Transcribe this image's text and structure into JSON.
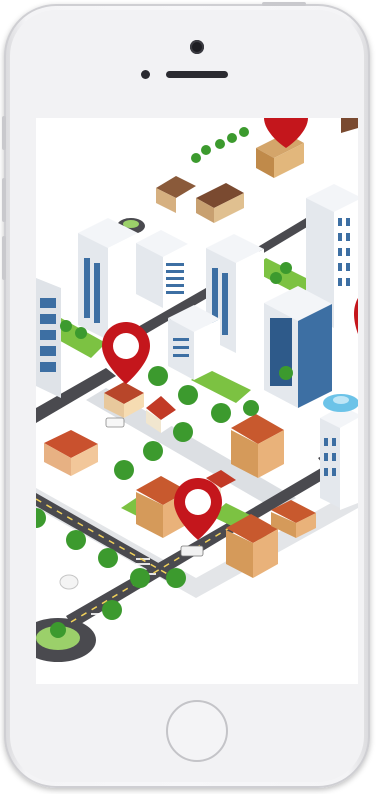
{
  "device": {
    "model": "iPhone",
    "color": "#f2f2f4"
  },
  "screen": {
    "content": "isometric-city-map",
    "pins": 4,
    "pin_color": "#c4161c"
  },
  "colors": {
    "road": "#4a4a4f",
    "grass": "#7cc242",
    "tree": "#3c9a2e",
    "roof": "#b8462a",
    "building": "#e9edf2",
    "glass": "#3d6fa3"
  }
}
